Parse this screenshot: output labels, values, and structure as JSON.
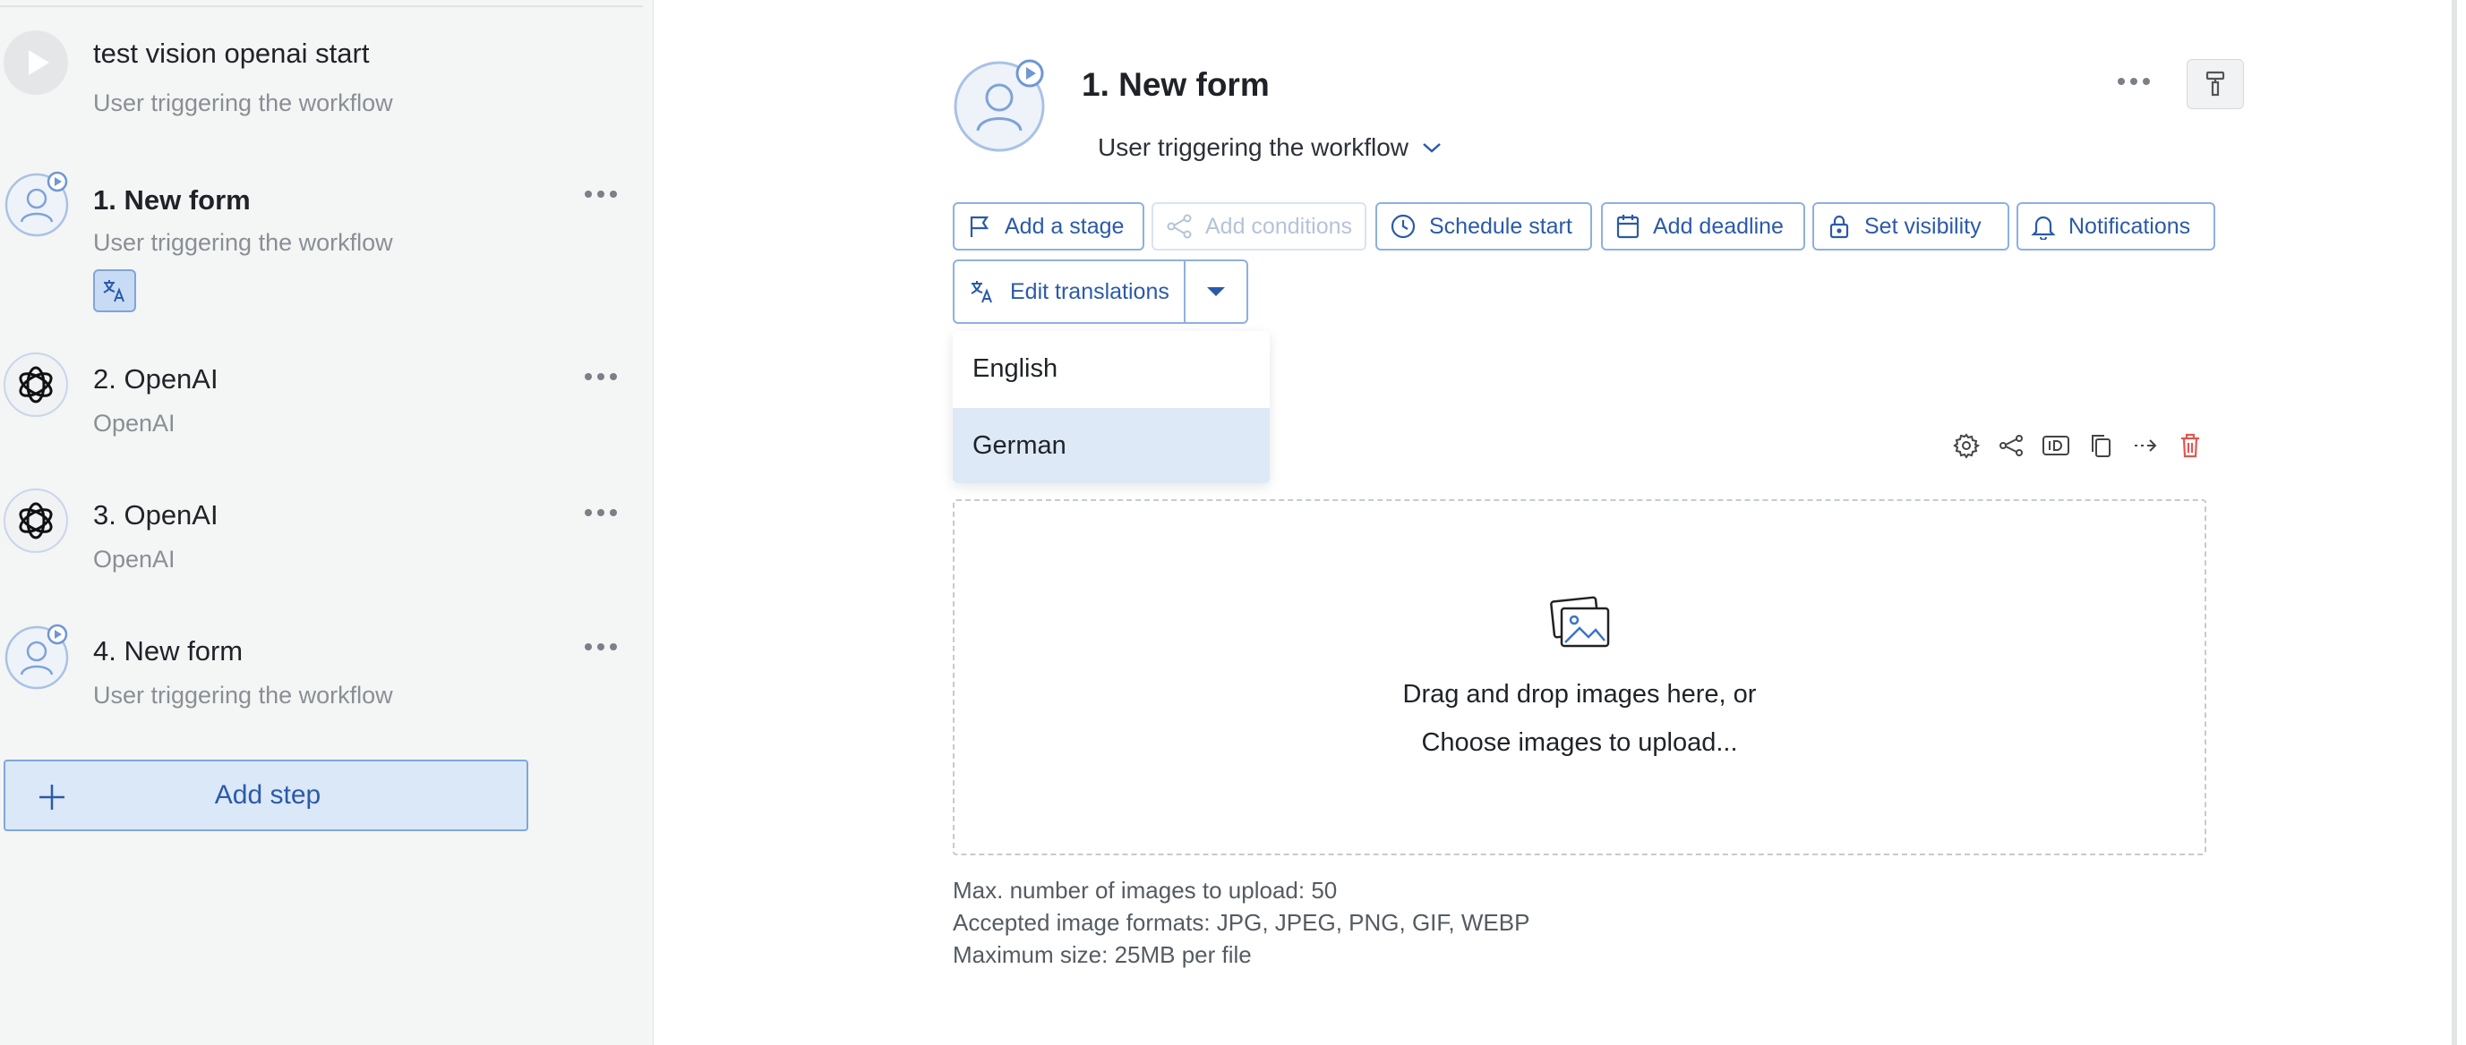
{
  "sidebar": {
    "workflow_name": "test vision openai start",
    "workflow_subtitle": "User triggering the workflow",
    "steps": [
      {
        "title": "1. New form",
        "subtitle": "User triggering the workflow"
      },
      {
        "title": "2. OpenAI",
        "subtitle": "OpenAI"
      },
      {
        "title": "3. OpenAI",
        "subtitle": "OpenAI"
      },
      {
        "title": "4. New form",
        "subtitle": "User triggering the workflow"
      }
    ],
    "add_step_label": "Add step"
  },
  "header": {
    "title": "1. New form",
    "trigger_select_value": "User triggering the workflow"
  },
  "toolbar": {
    "add_stage": "Add a stage",
    "add_conditions": "Add conditions",
    "schedule_start": "Schedule start",
    "add_deadline": "Add deadline",
    "set_visibility": "Set visibility",
    "notifications": "Notifications",
    "edit_translations": "Edit translations"
  },
  "language_menu": {
    "options": [
      "English",
      "German"
    ],
    "selected": "German"
  },
  "upload": {
    "drop_text": "Drag and drop images here, or",
    "choose_text": "Choose images to upload...",
    "max_count": "Max. number of images to upload: 50",
    "formats": "Accepted image formats: JPG, JPEG, PNG, GIF, WEBP",
    "max_size": "Maximum size: 25MB per file"
  },
  "colors": {
    "accent": "#2b5aa8",
    "accent_border": "#8eb0e0",
    "sidebar_bg": "#f4f5f5",
    "selected_bg": "#dde9f6",
    "danger": "#e0574f"
  },
  "icons": {
    "start": "play-icon",
    "form": "user-avatar-icon",
    "openai": "openai-logo-icon",
    "translate": "translate-icon",
    "more": "more-horizontal-icon"
  }
}
